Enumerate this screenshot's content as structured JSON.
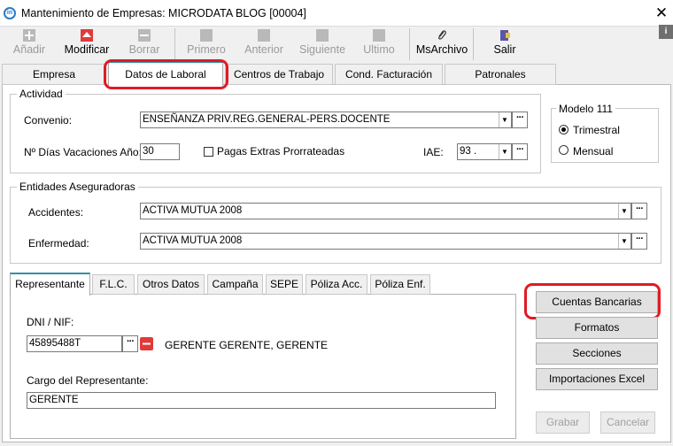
{
  "window": {
    "title": "Mantenimiento de Empresas: MICRODATA BLOG [00004]",
    "close": "✕",
    "app_icon": "in"
  },
  "toolbar": {
    "add": "Añadir",
    "edit": "Modificar",
    "delete": "Borrar",
    "first": "Primero",
    "prev": "Anterior",
    "next": "Siguiente",
    "last": "Ultimo",
    "msarchivo": "MsArchivo",
    "exit": "Salir"
  },
  "colors": {
    "accent": "#2f8fa8",
    "highlight": "#e01b24",
    "icon_red": "#e03a3a"
  },
  "tabs": [
    "Empresa",
    "Datos de Laboral",
    "Centros de Trabajo",
    "Cond. Facturación",
    "Patronales"
  ],
  "actividad": {
    "legend": "Actividad",
    "convenio_label": "Convenio:",
    "convenio_value": "ENSEÑANZA PRIV.REG.GENERAL-PERS.DOCENTE",
    "dias_label": "Nº Días Vacaciones Año:",
    "dias_value": "30",
    "pagas_label": "Pagas Extras Prorrateadas",
    "iae_label": "IAE:",
    "iae_value": "93 ."
  },
  "modelo": {
    "legend": "Modelo 111",
    "opt1": "Trimestral",
    "opt2": "Mensual"
  },
  "entidades": {
    "legend": "Entidades Aseguradoras",
    "accidentes_label": "Accidentes:",
    "accidentes_value": "ACTIVA MUTUA 2008",
    "enfermedad_label": "Enfermedad:",
    "enfermedad_value": "ACTIVA MUTUA 2008"
  },
  "inner_tabs": [
    "Representante",
    "F.L.C.",
    "Otros Datos",
    "Campaña",
    "SEPE",
    "Póliza Acc.",
    "Póliza Enf."
  ],
  "representante": {
    "dni_label": "DNI / NIF:",
    "dni_value": "45895488T",
    "name": "GERENTE GERENTE, GERENTE",
    "cargo_label": "Cargo del Representante:",
    "cargo_value": "GERENTE"
  },
  "side_buttons": {
    "cuentas": "Cuentas Bancarias",
    "formatos": "Formatos",
    "secciones": "Secciones",
    "importaciones": "Importaciones Excel",
    "grabar": "Grabar",
    "cancelar": "Cancelar"
  }
}
